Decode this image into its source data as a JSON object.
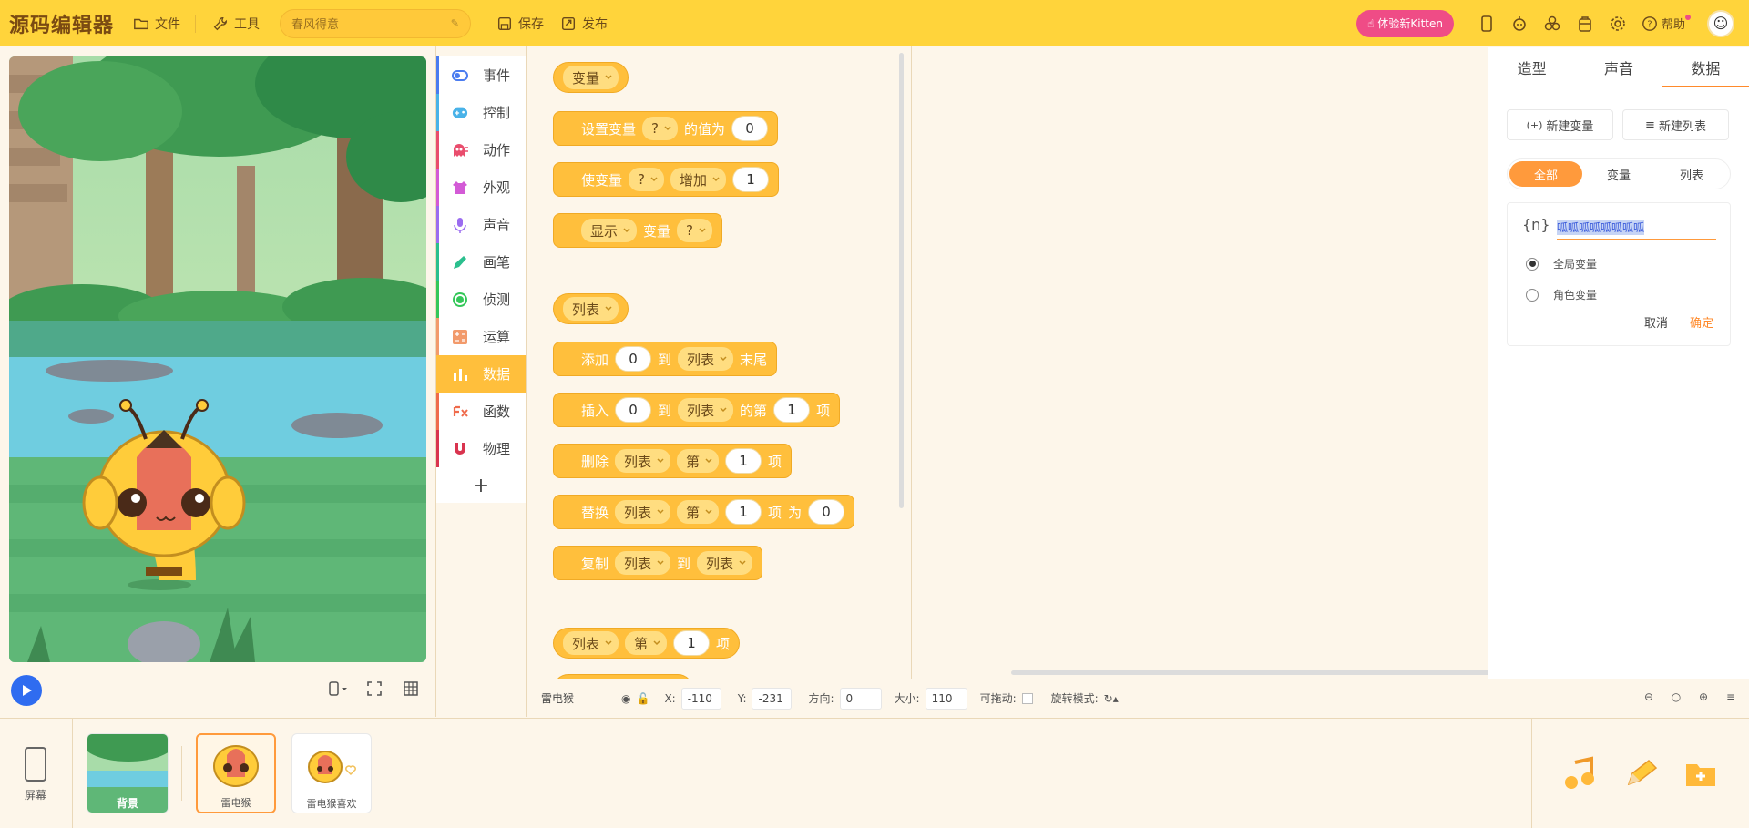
{
  "topbar": {
    "logo": "源码编辑器",
    "file_label": "文件",
    "tools_label": "工具",
    "project_title": "春风得意",
    "save_label": "保存",
    "publish_label": "发布",
    "kitten_label": "体验新Kitten",
    "help_label": "帮助"
  },
  "stage": {
    "tools": [
      "phone-icon",
      "fullscreen-icon",
      "grid-icon"
    ]
  },
  "categories": [
    {
      "label": "事件",
      "icon": "toggle-icon",
      "color": "#4a7cf0"
    },
    {
      "label": "控制",
      "icon": "gamepad-icon",
      "color": "#49b2e8"
    },
    {
      "label": "动作",
      "icon": "ghost-icon",
      "color": "#e94d6d"
    },
    {
      "label": "外观",
      "icon": "shirt-icon",
      "color": "#d35ad6"
    },
    {
      "label": "声音",
      "icon": "mic-icon",
      "color": "#9b6cf0"
    },
    {
      "label": "画笔",
      "icon": "pen-icon",
      "color": "#2bbf8e"
    },
    {
      "label": "侦测",
      "icon": "target-icon",
      "color": "#34c759"
    },
    {
      "label": "运算",
      "icon": "calc-icon",
      "color": "#f29a6b"
    },
    {
      "label": "数据",
      "icon": "bars-icon",
      "color": "#ffffff"
    },
    {
      "label": "函数",
      "icon": "function-icon",
      "color": "#ef6b4c"
    },
    {
      "label": "物理",
      "icon": "magnet-icon",
      "color": "#d9344f"
    }
  ],
  "blocks": {
    "var_hat": "变量",
    "set_var": {
      "a": "设置变量",
      "dd": "?",
      "b": "的值为",
      "val": "0"
    },
    "change_var": {
      "a": "使变量",
      "dd": "?",
      "op": "增加",
      "val": "1"
    },
    "show_var": {
      "op": "显示",
      "a": "变量",
      "dd": "?"
    },
    "list_hat": "列表",
    "add": {
      "a": "添加",
      "val": "0",
      "b": "到",
      "dd": "列表",
      "c": "末尾"
    },
    "insert": {
      "a": "插入",
      "val": "0",
      "b": "到",
      "dd": "列表",
      "c": "的第",
      "idx": "1",
      "d": "项"
    },
    "delete": {
      "a": "删除",
      "dd": "列表",
      "dd2": "第",
      "idx": "1",
      "b": "项"
    },
    "replace": {
      "a": "替换",
      "dd": "列表",
      "dd2": "第",
      "idx": "1",
      "b": "项",
      "c": "为",
      "val": "0"
    },
    "copy": {
      "a": "复制",
      "dd": "列表",
      "b": "到",
      "dd2": "列表"
    },
    "item": {
      "dd": "列表",
      "dd2": "第",
      "idx": "1",
      "b": "项"
    }
  },
  "panel": {
    "tabs": [
      "造型",
      "声音",
      "数据"
    ],
    "new_var_label": "新建变量",
    "new_list_label": "新建列表",
    "filters": [
      "全部",
      "变量",
      "列表"
    ],
    "var_icon_text": "{n}",
    "var_name_value": "呱呱呱呱呱呱呱呱",
    "scope_global": "全局变量",
    "scope_sprite": "角色变量",
    "cancel_label": "取消",
    "confirm_label": "确定"
  },
  "props": {
    "sprite_name": "雷电猴",
    "x_label": "X:",
    "x_value": "-110",
    "y_label": "Y:",
    "y_value": "-231",
    "dir_label": "方向:",
    "dir_value": "0",
    "size_label": "大小:",
    "size_value": "110",
    "drag_label": "可拖动:",
    "rotate_label": "旋转模式:"
  },
  "bottom": {
    "screen_label": "屏幕",
    "bg_label": "背景",
    "sprites": [
      "雷电猴",
      "雷电猴喜欢"
    ]
  }
}
